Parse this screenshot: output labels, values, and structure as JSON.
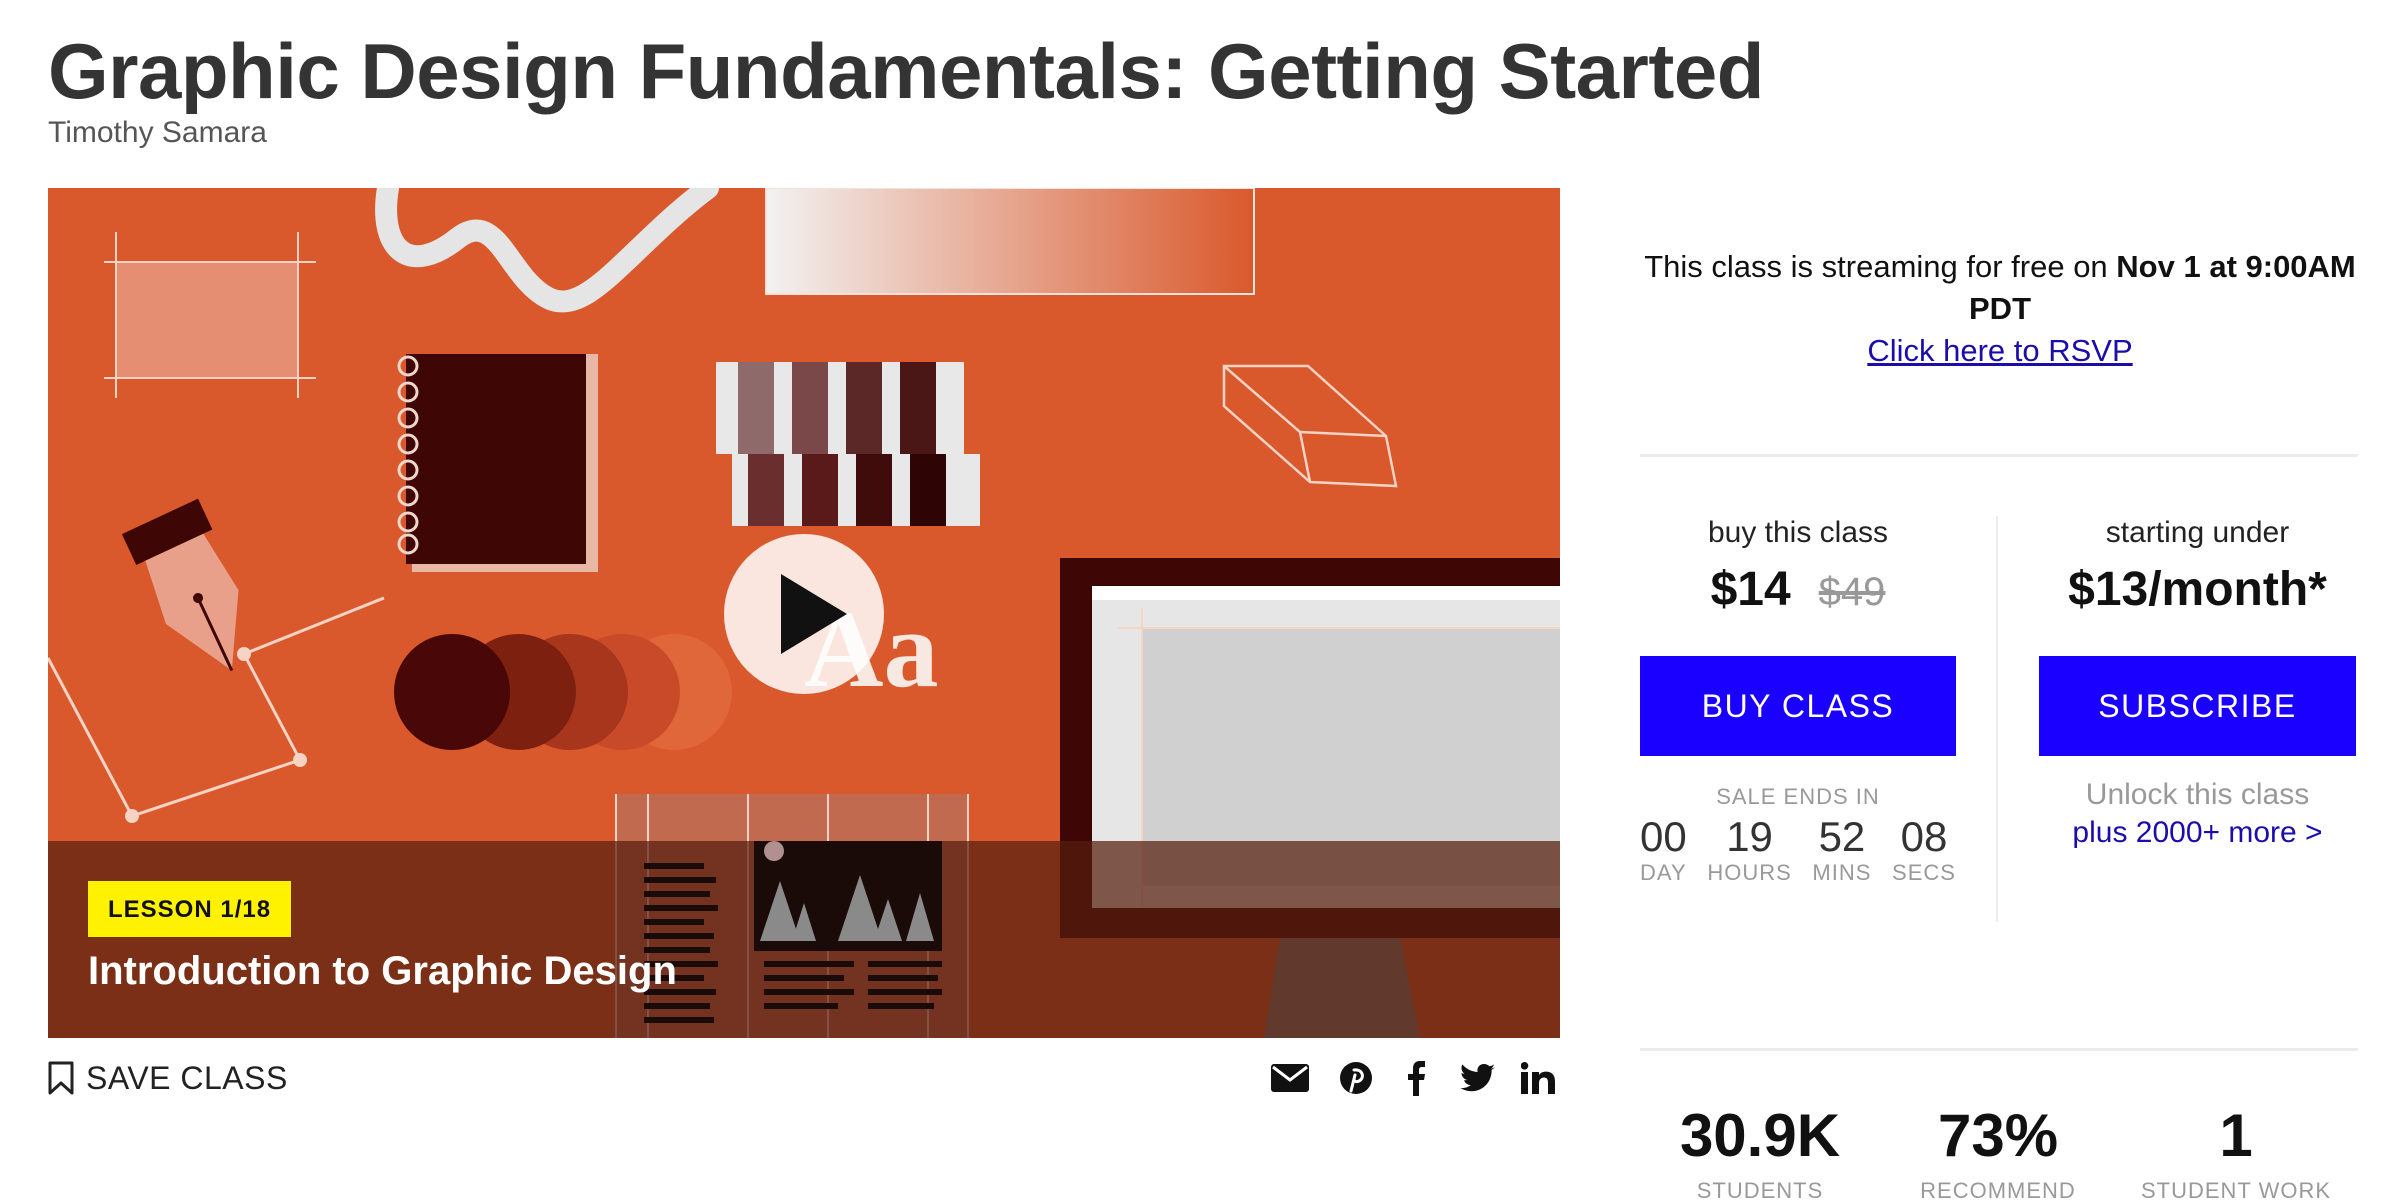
{
  "course": {
    "title": "Graphic Design Fundamentals: Getting Started",
    "author": "Timothy Samara"
  },
  "video": {
    "lesson_badge": "LESSON 1/18",
    "lesson_title": "Introduction to Graphic Design",
    "background_color": "#D9592C"
  },
  "actions": {
    "save_label": "SAVE CLASS",
    "share_icons": [
      "email-icon",
      "pinterest-icon",
      "facebook-icon",
      "twitter-icon",
      "linkedin-icon"
    ]
  },
  "stream": {
    "text_prefix": "This class is streaming for free on ",
    "date_bold": "Nov 1 at 9:00AM PDT",
    "rsvp_link": "Click here to RSVP"
  },
  "buy": {
    "label": "buy this class",
    "price": "$14",
    "original_price": "$49",
    "button": "BUY CLASS",
    "sale_ends_label": "SALE ENDS IN",
    "countdown": [
      {
        "value": "00",
        "unit": "DAY"
      },
      {
        "value": "19",
        "unit": "HOURS"
      },
      {
        "value": "52",
        "unit": "MINS"
      },
      {
        "value": "08",
        "unit": "SECS"
      }
    ]
  },
  "subscribe": {
    "label": "starting under",
    "price": "$13/month*",
    "button": "SUBSCRIBE",
    "unlock_text": "Unlock this class",
    "more_link": "plus 2000+ more >"
  },
  "stats": [
    {
      "value": "30.9K",
      "label": "STUDENTS"
    },
    {
      "value": "73%",
      "label": "RECOMMEND"
    },
    {
      "value": "1",
      "label": "STUDENT WORK"
    }
  ],
  "colors": {
    "accent_button": "#1a00ff",
    "link": "#1a0dab",
    "badge": "#FFF200"
  }
}
